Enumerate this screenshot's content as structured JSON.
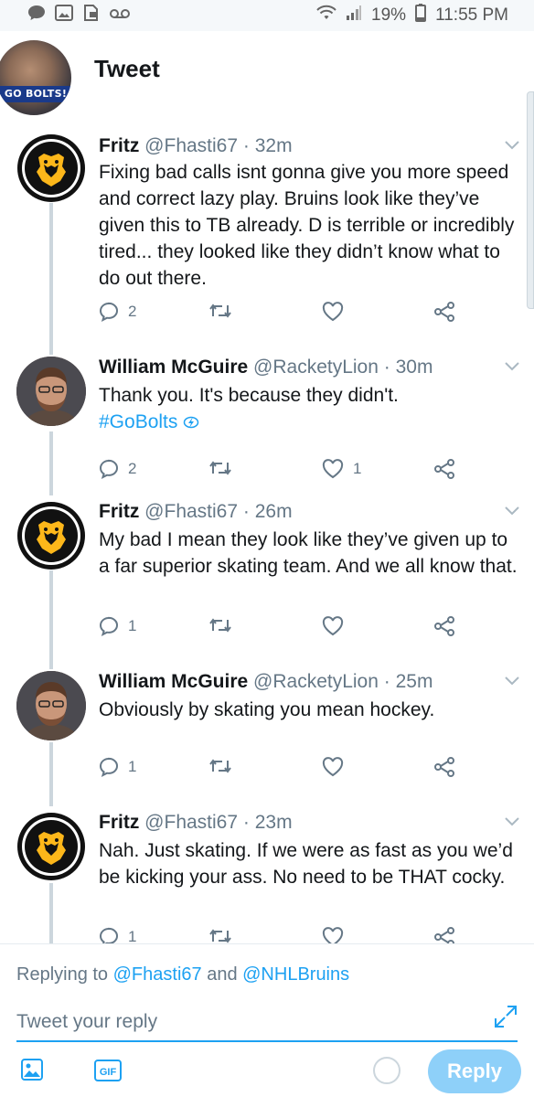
{
  "status_bar": {
    "battery": "19%",
    "time": "11:55 PM"
  },
  "header": {
    "title": "Tweet",
    "avatar_badge": "GO BOLTS!"
  },
  "tweets": [
    {
      "name": "Fritz",
      "handle": "@Fhasti67",
      "time": "· 32m",
      "avatar": "bruins-logo",
      "text": "Fixing bad calls isnt gonna give you more speed and correct lazy play.  Bruins look like they’ve given this to TB already. D is terrible or incredibly tired... they looked like they didn’t know what to do out there.",
      "replies": "2",
      "retweets": "",
      "likes": ""
    },
    {
      "name": "William McGuire",
      "handle": "@RacketyLion",
      "time": "· 30m",
      "avatar": "person-photo",
      "text": "Thank you. It's because they didn't.",
      "hashtag": "#GoBolts",
      "replies": "2",
      "retweets": "",
      "likes": "1"
    },
    {
      "name": "Fritz",
      "handle": "@Fhasti67",
      "time": "· 26m",
      "avatar": "bruins-logo",
      "text": "My bad I mean they look like they’ve given up to a far superior skating team. And we all know that.",
      "replies": "1",
      "retweets": "",
      "likes": ""
    },
    {
      "name": "William McGuire",
      "handle": "@RacketyLion",
      "time": "· 25m",
      "avatar": "person-photo",
      "text": "Obviously by skating you mean hockey.",
      "replies": "1",
      "retweets": "",
      "likes": ""
    },
    {
      "name": "Fritz",
      "handle": "@Fhasti67",
      "time": "· 23m",
      "avatar": "bruins-logo",
      "text": "Nah. Just skating. If we were as fast as you we’d be kicking your ass.  No need to be THAT cocky.",
      "replies": "1",
      "retweets": "",
      "likes": ""
    }
  ],
  "composer": {
    "replying_prefix": "Replying to ",
    "mention_1": "@Fhasti67",
    "conjunction": " and ",
    "mention_2": "@NHLBruins",
    "placeholder": "Tweet your reply",
    "gif_label": "GIF",
    "reply_button": "Reply"
  },
  "colors": {
    "accent": "#1da1f2",
    "muted": "#657786",
    "reply_button_disabled": "#8ed0f9"
  }
}
